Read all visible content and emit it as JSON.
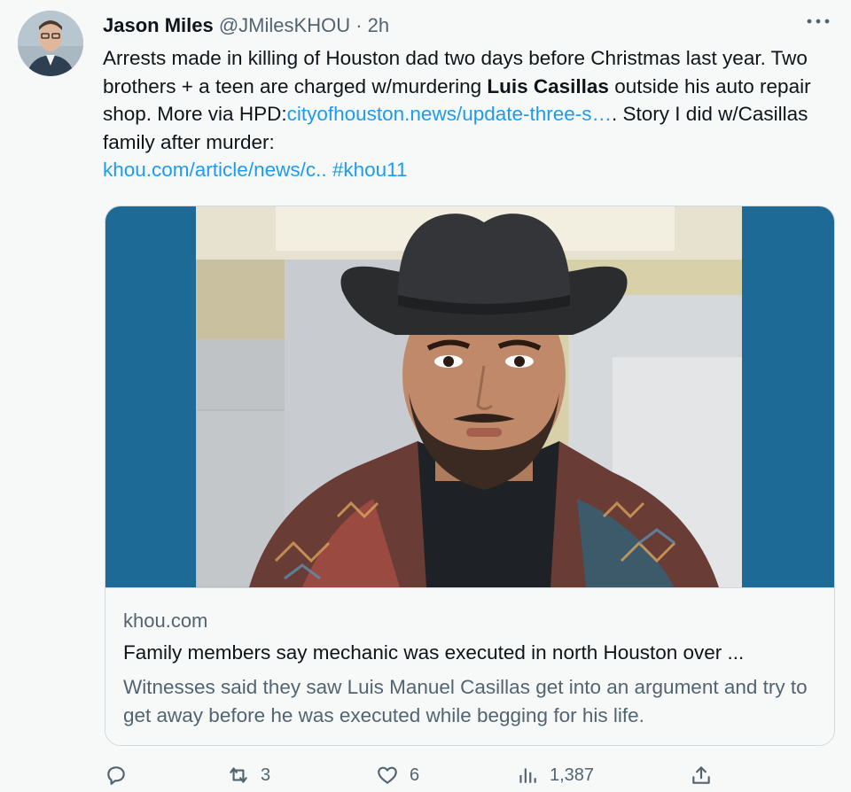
{
  "tweet": {
    "author_name": "Jason Miles",
    "handle": "@JMilesKHOU",
    "separator": "·",
    "time": "2h",
    "more_icon": "more-horizontal-icon",
    "text_part1": "Arrests made in killing of Houston dad two days before Christmas last year. Two brothers + a teen are charged w/murdering ",
    "bold_name": "Luis Casillas",
    "text_part2": " outside his auto repair shop. More via HPD:",
    "link1": "cityofhouston.news/update-three-s…",
    "text_part3": ". Story I did w/Casillas family after murder: ",
    "link2": "khou.com/article/news/c..",
    "hashtag": "#khou11"
  },
  "card": {
    "domain": "khou.com",
    "title": "Family members say mechanic was executed in north Houston over ...",
    "description": "Witnesses said they saw Luis Manuel Casillas get into an argument and try to get away before he was executed while begging for his life."
  },
  "actions": {
    "reply_icon": "reply-icon",
    "retweet_icon": "retweet-icon",
    "retweet_count": "3",
    "like_icon": "heart-icon",
    "like_count": "6",
    "views_icon": "views-chart-icon",
    "views_count": "1,387",
    "share_icon": "share-icon"
  }
}
